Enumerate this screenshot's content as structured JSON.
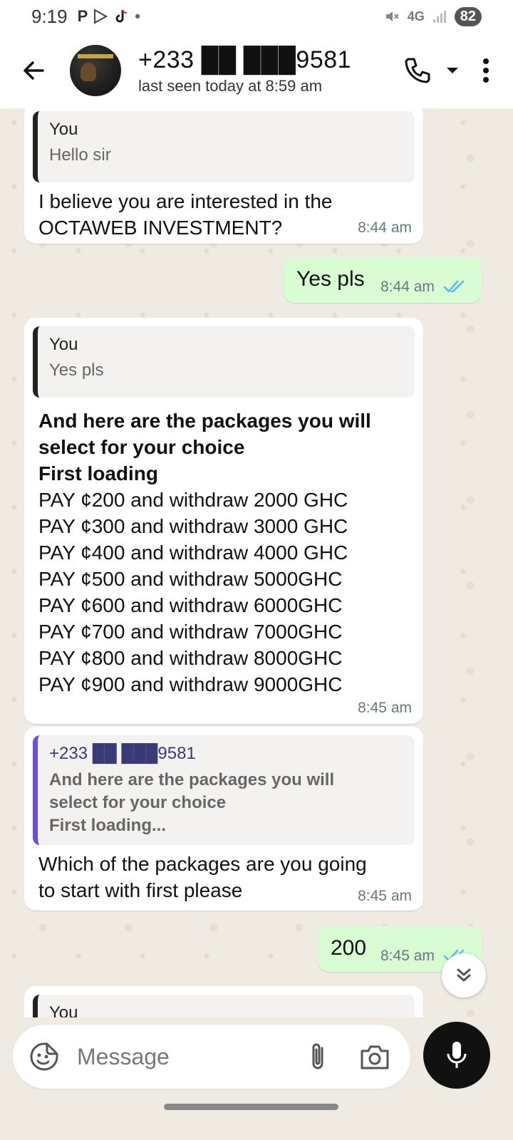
{
  "status_bar": {
    "time": "9:19",
    "app_icons": [
      "P",
      "play-store-icon",
      "tiktok-icon",
      "•"
    ],
    "network": "4G",
    "battery": "82"
  },
  "header": {
    "contact_name": "+233 ██ ███9581",
    "last_seen": "last seen today at 8:59 am"
  },
  "messages": [
    {
      "direction": "in",
      "quote_author": "You",
      "quote_text": "Hello sir",
      "lines": [
        "I believe you are interested in the",
        "OCTAWEB INVESTMENT?"
      ],
      "time": "8:44 am"
    },
    {
      "direction": "out",
      "text": "Yes pls",
      "time": "8:44 am",
      "status": "read"
    },
    {
      "direction": "in",
      "quote_author": "You",
      "quote_text": "Yes pls",
      "bold_lines": [
        "And here are the packages you will",
        "select for your choice",
        "First loading"
      ],
      "lines": [
        "PAY ¢200  and withdraw 2000 GHC",
        "PAY ¢300  and withdraw 3000 GHC",
        "PAY ¢400  and withdraw 4000 GHC",
        "PAY ¢500  and withdraw 5000GHC",
        "PAY ¢600  and withdraw 6000GHC",
        "PAY ¢700  and withdraw 7000GHC",
        "PAY ¢800  and withdraw 8000GHC",
        "PAY ¢900 and withdraw 9000GHC"
      ],
      "time": "8:45 am"
    },
    {
      "direction": "in",
      "quote_author": "+233 ██ ███9581",
      "quote_lines": [
        "And here are the packages you will",
        "select for your choice",
        "First loading..."
      ],
      "lines": [
        "Which of the packages are you going",
        "to start with first please"
      ],
      "time": "8:45 am"
    },
    {
      "direction": "out",
      "text": "200",
      "time": "8:45 am",
      "status": "read"
    },
    {
      "direction": "in",
      "quote_author": "You"
    }
  ],
  "composer": {
    "placeholder": "Message"
  },
  "colors": {
    "chat_bg": "#efeae2",
    "incoming_bubble": "#ffffff",
    "outgoing_bubble": "#d9fdd3",
    "read_ticks": "#53bdeb",
    "quote_bar_self": "#222222",
    "quote_bar_contact": "#6c4fcf",
    "mic_button": "#111111"
  }
}
